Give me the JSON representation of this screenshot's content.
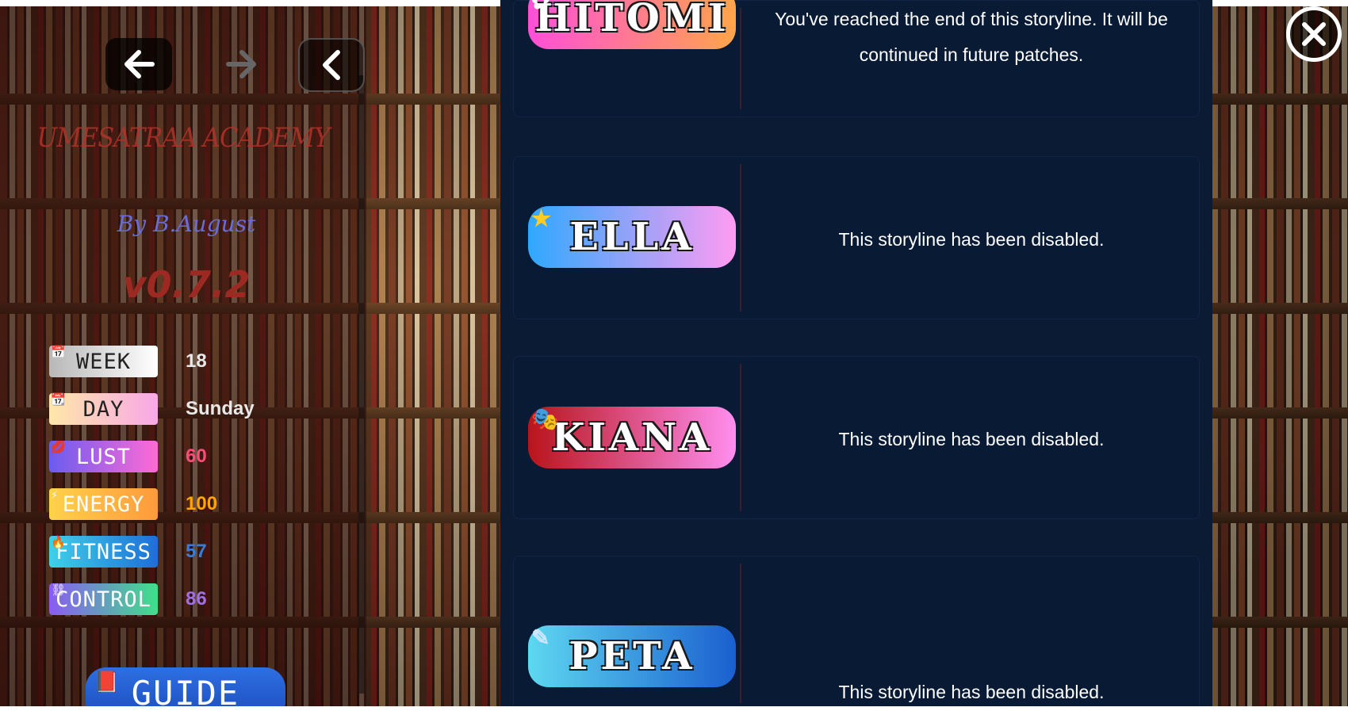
{
  "sidebar": {
    "title": "UMESATRAA ACADEMY",
    "author": "By B.August",
    "version": "v0.7.2",
    "stats": [
      {
        "label": "WEEK",
        "value": "18",
        "icon": "calendar-icon"
      },
      {
        "label": "DAY",
        "value": "Sunday",
        "icon": "calendar-page-icon"
      },
      {
        "label": "LUST",
        "value": "60",
        "icon": "lips-icon"
      },
      {
        "label": "ENERGY",
        "value": "100",
        "icon": "lightning-icon"
      },
      {
        "label": "FITNESS",
        "value": "57",
        "icon": "flame-icon"
      },
      {
        "label": "CONTROL",
        "value": "86",
        "icon": "chain-icon"
      }
    ],
    "guide_label": "GUIDE"
  },
  "stories": [
    {
      "name": "HITOMI",
      "message": "You've reached the end of this storyline. It will be continued in future patches.",
      "icon": "flower-icon"
    },
    {
      "name": "ELLA",
      "message": "This storyline has been disabled.",
      "icon": "star-icon"
    },
    {
      "name": "KIANA",
      "message": "This storyline has been disabled.",
      "icon": "theater-masks-icon"
    },
    {
      "name": "PETA",
      "message": "This storyline has been disabled.",
      "icon": "pen-icon"
    }
  ],
  "colors": {
    "panel_bg": "#0b1b34",
    "card_bg": "#091a35",
    "lust_value": "#ff4d7a",
    "energy_value": "#ffa500",
    "fitness_value": "#3a7bd5",
    "control_value": "#a070e0"
  }
}
